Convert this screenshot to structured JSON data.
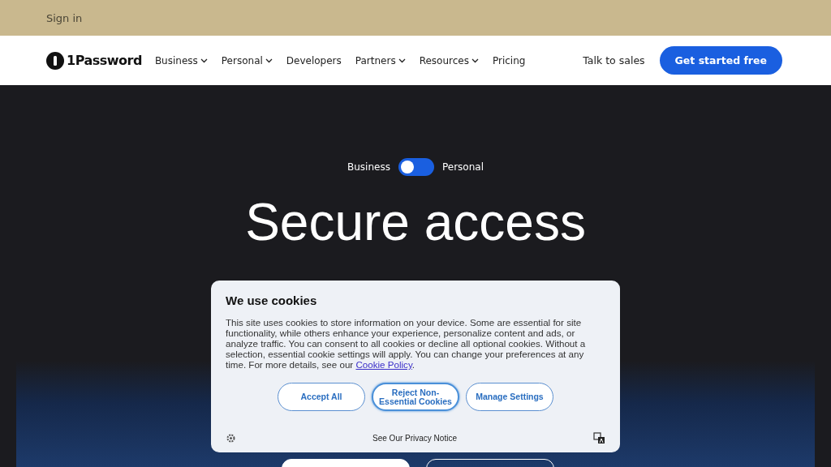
{
  "top_bar": {
    "sign_in": "Sign in"
  },
  "nav": {
    "logo": "1Password",
    "items": [
      {
        "label": "Business",
        "dropdown": true
      },
      {
        "label": "Personal",
        "dropdown": true
      },
      {
        "label": "Developers",
        "dropdown": false
      },
      {
        "label": "Partners",
        "dropdown": true
      },
      {
        "label": "Resources",
        "dropdown": true
      },
      {
        "label": "Pricing",
        "dropdown": false
      }
    ],
    "talk": "Talk to sales",
    "cta": "Get started free"
  },
  "hero": {
    "toggle": {
      "left": "Business",
      "right": "Personal",
      "on": false
    },
    "title": "Secure access"
  },
  "cookie_dialog": {
    "title": "We use cookies",
    "body": "This site uses cookies to store information on your device. Some are essential for site functionality, while others enhance your experience, personalize content and ads, or analyze traffic. You can consent to all cookies or decline all optional cookies. Without a selection, essential cookie settings will apply. You can change your preferences at any time. For more details, see our ",
    "link": "Cookie Policy",
    "after_link": ".",
    "buttons": [
      {
        "label": "Accept All",
        "selected": false
      },
      {
        "label": "Reject Non-Essential Cookies",
        "selected": true
      },
      {
        "label": "Manage Settings",
        "selected": false
      }
    ],
    "privacy": "See Our Privacy Notice"
  }
}
